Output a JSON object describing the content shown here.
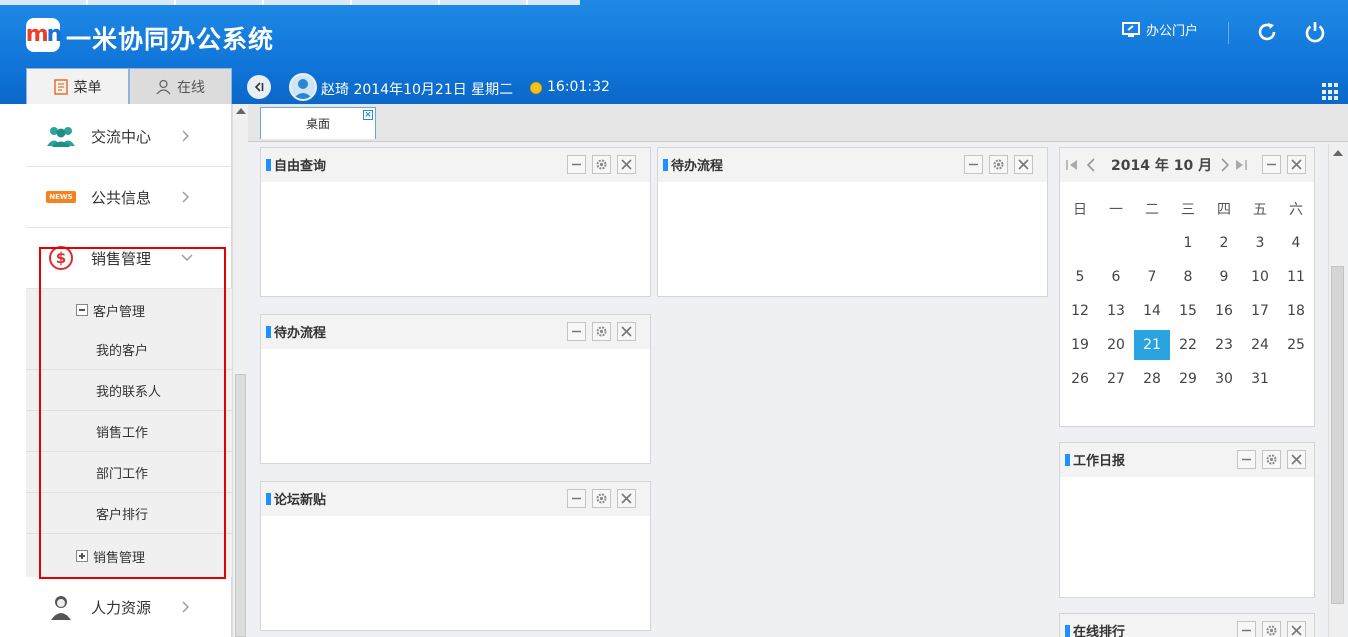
{
  "header": {
    "app_title": "一米协同办公系统",
    "portal_label": "办公门户",
    "tab_menu": "菜单",
    "tab_online": "在线",
    "user_line": "赵琦 2014年10月21日 星期二",
    "time": "16:01:32"
  },
  "sidebar": {
    "items": [
      {
        "label": "交流中心",
        "icon": "people-group-icon"
      },
      {
        "label": "公共信息",
        "icon": "news-icon",
        "icon_text": "NEWS"
      },
      {
        "label": "销售管理",
        "icon": "dollar-icon",
        "icon_text": "$"
      },
      {
        "label": "人力资源",
        "icon": "person-icon"
      }
    ],
    "sub_group_open": "客户管理",
    "sub_items": [
      "我的客户",
      "我的联系人",
      "销售工作",
      "部门工作",
      "客户排行"
    ],
    "sub_group_closed": "销售管理"
  },
  "main": {
    "desk_tab": "桌面",
    "desk_tab_close": "×",
    "panels": {
      "free_query": "自由查询",
      "pending_1": "待办流程",
      "pending_2": "待办流程",
      "forum": "论坛新贴",
      "work_log": "工作日报",
      "online_rank": "在线排行"
    },
    "calendar": {
      "title": "2014 年 10 月",
      "weekdays": [
        "日",
        "一",
        "二",
        "三",
        "四",
        "五",
        "六"
      ],
      "weeks": [
        [
          "",
          "",
          "",
          "1",
          "2",
          "3",
          "4"
        ],
        [
          "5",
          "6",
          "7",
          "8",
          "9",
          "10",
          "11"
        ],
        [
          "12",
          "13",
          "14",
          "15",
          "16",
          "17",
          "18"
        ],
        [
          "19",
          "20",
          "21",
          "22",
          "23",
          "24",
          "25"
        ],
        [
          "26",
          "27",
          "28",
          "29",
          "30",
          "31",
          ""
        ]
      ],
      "selected": "21"
    }
  },
  "colors": {
    "header_blue": "#0e72d6",
    "accent_blue": "#1e90ff",
    "selected_day": "#2aa4e0",
    "highlight_red": "#e60000"
  }
}
